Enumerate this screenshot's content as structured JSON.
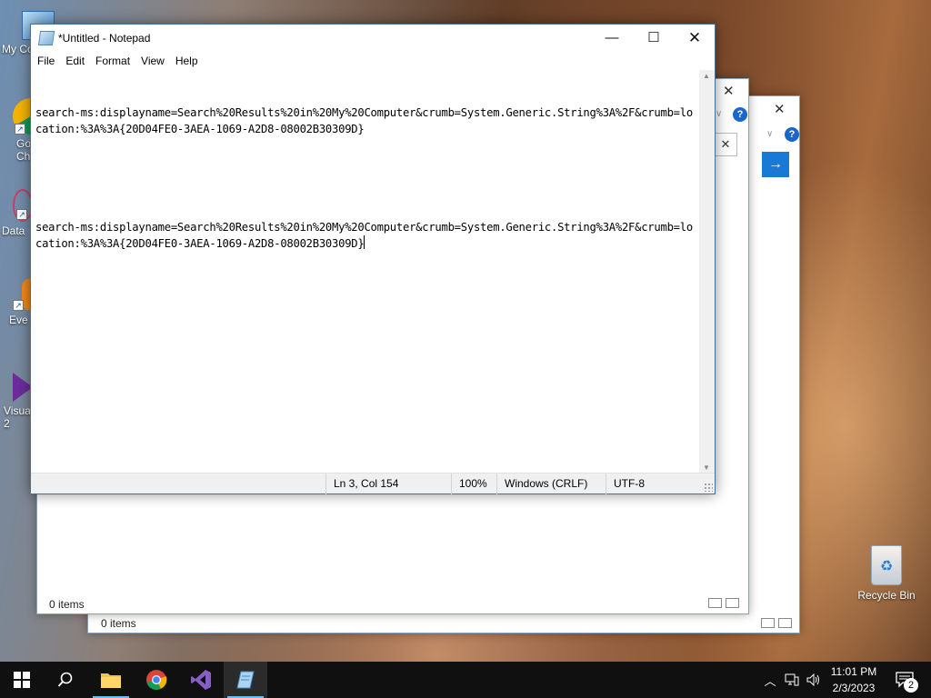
{
  "notepad": {
    "title": "*Untitled - Notepad",
    "menu": [
      "File",
      "Edit",
      "Format",
      "View",
      "Help"
    ],
    "lines": [
      "search-ms:displayname=Search%20Results%20in%20My%20Computer&crumb=System.Generic.String%3A%2F&crumb=location:%3A%3A{20D04FE0-3AEA-1069-A2D8-08002B30309D}",
      "",
      "search-ms:displayname=Search%20Results%20in%20My%20Computer&crumb=System.Generic.String%3A%2F&crumb=location:%3A%3A{20D04FE0-3AEA-1069-A2D8-08002B30309D}"
    ],
    "status": {
      "position": "Ln 3, Col 154",
      "zoom": "100%",
      "line_ending": "Windows (CRLF)",
      "encoding": "UTF-8"
    }
  },
  "explorer_back": {
    "status": "0 items"
  },
  "explorer_front": {
    "status": "0 items"
  },
  "desktop": {
    "icons": [
      "My Co",
      "Go Ch",
      "Data",
      "Eve",
      "Visua 2"
    ],
    "recycle_bin": "Recycle Bin"
  },
  "taskbar": {
    "time": "11:01 PM",
    "date": "2/3/2023",
    "notification_count": "2"
  }
}
